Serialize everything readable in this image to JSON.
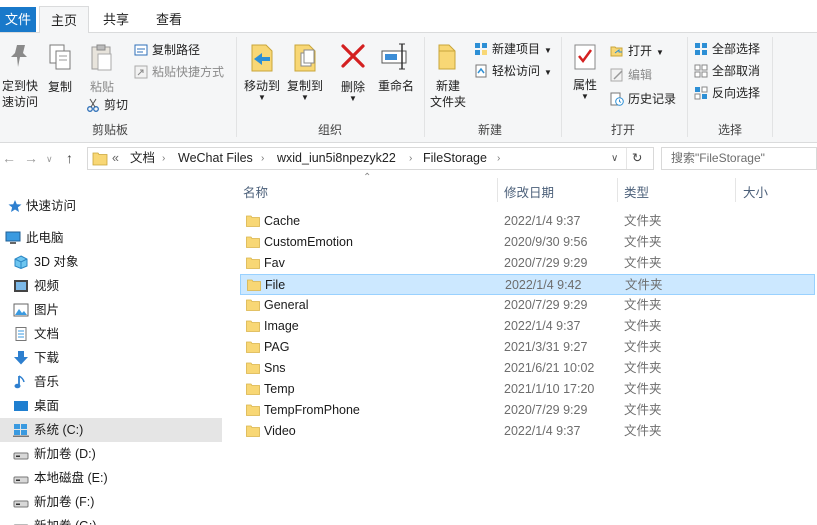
{
  "tabs": {
    "file": "文件",
    "home": "主页",
    "share": "共享",
    "view": "查看"
  },
  "ribbon": {
    "pin_quick_access": [
      "定到快",
      "速访问"
    ],
    "copy": "复制",
    "paste": "粘贴",
    "copy_path": "复制路径",
    "paste_shortcut": "粘贴快捷方式",
    "cut": "剪切",
    "clipboard_group": "剪贴板",
    "move_to": "移动到",
    "copy_to": "复制到",
    "delete": "删除",
    "rename": "重命名",
    "organize_group": "组织",
    "new_folder": [
      "新建",
      "文件夹"
    ],
    "new_item": "新建项目",
    "easy_access": "轻松访问",
    "new_group": "新建",
    "properties": "属性",
    "open": "打开",
    "edit": "编辑",
    "history": "历史记录",
    "open_group": "打开",
    "select_all": "全部选择",
    "select_none": "全部取消",
    "invert_selection": "反向选择",
    "select_group": "选择"
  },
  "address": {
    "prefix": "«",
    "crumbs": [
      "文档",
      "WeChat Files",
      "wxid_iun5i8npezyk22",
      "FileStorage"
    ],
    "search_placeholder": "搜索\"FileStorage\""
  },
  "nav": [
    {
      "label": "快速访问",
      "icon": "star-icon"
    },
    {
      "label": "此电脑",
      "icon": "computer-icon"
    },
    {
      "label": "3D 对象",
      "icon": "cube-icon"
    },
    {
      "label": "视频",
      "icon": "video-icon"
    },
    {
      "label": "图片",
      "icon": "picture-icon"
    },
    {
      "label": "文档",
      "icon": "document-icon"
    },
    {
      "label": "下载",
      "icon": "download-icon"
    },
    {
      "label": "音乐",
      "icon": "music-icon"
    },
    {
      "label": "桌面",
      "icon": "desktop-icon"
    },
    {
      "label": "系统 (C:)",
      "icon": "system-drive-icon"
    },
    {
      "label": "新加卷 (D:)",
      "icon": "drive-icon"
    },
    {
      "label": "本地磁盘 (E:)",
      "icon": "drive-icon"
    },
    {
      "label": "新加卷 (F:)",
      "icon": "drive-icon"
    },
    {
      "label": "新加卷 (G:)",
      "icon": "drive-icon"
    }
  ],
  "columns": {
    "name": "名称",
    "date": "修改日期",
    "type": "类型",
    "size": "大小"
  },
  "files": [
    {
      "name": "Cache",
      "date": "2022/1/4 9:37",
      "type": "文件夹"
    },
    {
      "name": "CustomEmotion",
      "date": "2020/9/30 9:56",
      "type": "文件夹"
    },
    {
      "name": "Fav",
      "date": "2020/7/29 9:29",
      "type": "文件夹"
    },
    {
      "name": "File",
      "date": "2022/1/4 9:42",
      "type": "文件夹"
    },
    {
      "name": "General",
      "date": "2020/7/29 9:29",
      "type": "文件夹"
    },
    {
      "name": "Image",
      "date": "2022/1/4 9:37",
      "type": "文件夹"
    },
    {
      "name": "PAG",
      "date": "2021/3/31 9:27",
      "type": "文件夹"
    },
    {
      "name": "Sns",
      "date": "2021/6/21 10:02",
      "type": "文件夹"
    },
    {
      "name": "Temp",
      "date": "2021/1/10 17:20",
      "type": "文件夹"
    },
    {
      "name": "TempFromPhone",
      "date": "2020/7/29 9:29",
      "type": "文件夹"
    },
    {
      "name": "Video",
      "date": "2022/1/4 9:37",
      "type": "文件夹"
    }
  ],
  "selected_file": "File",
  "colors": {
    "accent": "#1979ca",
    "selection": "#cce8ff",
    "folder": "#f8d775"
  }
}
